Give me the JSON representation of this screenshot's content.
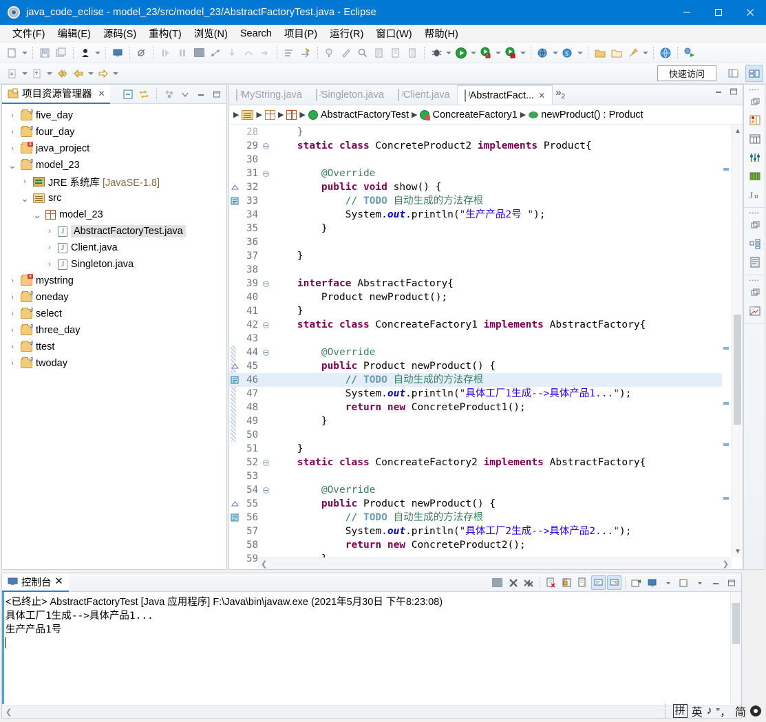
{
  "window": {
    "title": "java_code_eclise - model_23/src/model_23/AbstractFactoryTest.java - Eclipse",
    "app_icon": "eclipse-gear-icon",
    "minimize_label": "—",
    "maximize_label": "□",
    "close_label": "✕",
    "accent_color": "#0078d4"
  },
  "menubar": {
    "items": [
      {
        "label": "文件(F)",
        "name": "menu-file"
      },
      {
        "label": "编辑(E)",
        "name": "menu-edit"
      },
      {
        "label": "源码(S)",
        "name": "menu-source"
      },
      {
        "label": "重构(T)",
        "name": "menu-refactor"
      },
      {
        "label": "浏览(N)",
        "name": "menu-navigate"
      },
      {
        "label": "Search",
        "name": "menu-search"
      },
      {
        "label": "项目(P)",
        "name": "menu-project"
      },
      {
        "label": "运行(R)",
        "name": "menu-run"
      },
      {
        "label": "窗口(W)",
        "name": "menu-window"
      },
      {
        "label": "帮助(H)",
        "name": "menu-help"
      }
    ]
  },
  "toolbar": {
    "quick_access_label": "快速访问",
    "row1_icons": [
      "new-wizard-icon",
      "new-dropdown-arrow",
      "save-icon",
      "save-all-icon",
      "debug-perspective-icon",
      "debug-dropdown-arrow",
      "console-icon",
      "skip-breakpoints-icon",
      "resume-icon",
      "suspend-icon",
      "terminate-icon",
      "disconnect-icon",
      "step-into-icon",
      "step-over-icon",
      "step-return-icon",
      "drop-to-frame-icon",
      "use-step-filters-icon",
      "open-type-icon",
      "open-task-icon",
      "search-icon",
      "last-edit-location-icon",
      "next-annotation-icon",
      "previous-annotation-icon",
      "toggle-mark-occurrences-icon"
    ],
    "row2_icons": [
      "back-history-icon",
      "back-dropdown-arrow",
      "forward-history-icon",
      "forward-dropdown-arrow",
      "previous-edit-icon",
      "back-arrow-icon",
      "back-dropdown-arrow2",
      "forward-arrow-icon",
      "forward-dropdown-arrow2"
    ],
    "right_icons": [
      "debug-bug-icon",
      "debug-dropdown",
      "run-icon",
      "run-dropdown",
      "run-external-icon",
      "run-external-dropdown",
      "coverage-icon",
      "coverage-dropdown",
      "new-java-project-icon",
      "new-java-project-dropdown",
      "new-class-icon",
      "new-class-dropdown",
      "open-folder-icon",
      "open-package-icon",
      "pin-icon",
      "pin-dropdown",
      "web-browser-icon",
      "run-config-icon"
    ],
    "perspective_icons": [
      "open-perspective-icon",
      "java-perspective-icon"
    ]
  },
  "explorer": {
    "tab_label": "项目资源管理器",
    "tab_icon": "package-explorer-icon",
    "close_label": "✕",
    "tools": [
      "collapse-all-icon",
      "link-with-editor-icon",
      "view-menu-filter-icon",
      "view-menu-icon",
      "minimize-icon",
      "maximize-icon"
    ],
    "tree": [
      {
        "label": "five_day",
        "icon": "java-project-icon",
        "depth": 0,
        "twisty": "collapsed",
        "selected": false
      },
      {
        "label": "four_day",
        "icon": "java-project-icon",
        "depth": 0,
        "twisty": "collapsed",
        "selected": false
      },
      {
        "label": "java_project",
        "icon": "java-project-error-icon",
        "depth": 0,
        "twisty": "collapsed",
        "selected": false
      },
      {
        "label": "model_23",
        "icon": "java-project-icon",
        "depth": 0,
        "twisty": "expanded",
        "selected": false
      },
      {
        "label": "JRE 系统库 [JavaSE-1.8]",
        "icon": "jre-library-icon",
        "depth": 1,
        "twisty": "collapsed",
        "selected": false
      },
      {
        "label": "src",
        "icon": "source-folder-icon",
        "depth": 1,
        "twisty": "expanded",
        "selected": false
      },
      {
        "label": "model_23",
        "icon": "package-icon",
        "depth": 2,
        "twisty": "expanded",
        "selected": false
      },
      {
        "label": "AbstractFactoryTest.java",
        "icon": "java-file-icon",
        "depth": 3,
        "twisty": "collapsed",
        "selected": true
      },
      {
        "label": "Client.java",
        "icon": "java-file-icon",
        "depth": 3,
        "twisty": "collapsed",
        "selected": false
      },
      {
        "label": "Singleton.java",
        "icon": "java-file-icon",
        "depth": 3,
        "twisty": "collapsed",
        "selected": false
      },
      {
        "label": "mystring",
        "icon": "java-project-error-icon",
        "depth": 0,
        "twisty": "collapsed",
        "selected": false
      },
      {
        "label": "oneday",
        "icon": "java-project-icon",
        "depth": 0,
        "twisty": "collapsed",
        "selected": false
      },
      {
        "label": "select",
        "icon": "java-project-icon",
        "depth": 0,
        "twisty": "collapsed",
        "selected": false
      },
      {
        "label": "three_day",
        "icon": "java-project-icon",
        "depth": 0,
        "twisty": "collapsed",
        "selected": false
      },
      {
        "label": "ttest",
        "icon": "java-project-icon",
        "depth": 0,
        "twisty": "collapsed",
        "selected": false
      },
      {
        "label": "twoday",
        "icon": "java-project-icon",
        "depth": 0,
        "twisty": "collapsed",
        "selected": false
      }
    ]
  },
  "editor": {
    "tabs": [
      {
        "label": "MyString.java",
        "active": false,
        "icon": "java-file-icon"
      },
      {
        "label": "Singleton.java",
        "active": false,
        "icon": "java-file-icon"
      },
      {
        "label": "Client.java",
        "active": false,
        "icon": "java-file-icon"
      },
      {
        "label": "AbstractFact...",
        "active": true,
        "icon": "java-file-icon",
        "close_label": "✕"
      }
    ],
    "more_tabs_label": "»",
    "more_tabs_count": "2",
    "minimize_label": "minimize-icon",
    "maximize_label": "maximize-icon",
    "breadcrumb": [
      {
        "label": "",
        "icon": "source-folder-icon"
      },
      {
        "label": "",
        "icon": "package-root-icon"
      },
      {
        "label": "",
        "icon": "package-icon"
      },
      {
        "label": "AbstractFactoryTest",
        "icon": "class-icon"
      },
      {
        "label": "ConcreateFactory1",
        "icon": "inner-class-icon"
      },
      {
        "label": "newProduct() : Product",
        "icon": "method-icon"
      }
    ],
    "highlighted_line": 46,
    "lines": [
      {
        "n": 28,
        "fold": false,
        "mark": "",
        "partial": true,
        "tokens": [
          {
            "t": "    }",
            "c": "plain"
          }
        ]
      },
      {
        "n": 29,
        "fold": true,
        "mark": "",
        "tokens": [
          {
            "t": "    ",
            "c": "plain"
          },
          {
            "t": "static class",
            "c": "kw"
          },
          {
            "t": " ConcreteProduct2 ",
            "c": "plain"
          },
          {
            "t": "implements",
            "c": "kw"
          },
          {
            "t": " Product{",
            "c": "plain"
          }
        ]
      },
      {
        "n": 30,
        "fold": false,
        "mark": "",
        "tokens": []
      },
      {
        "n": 31,
        "fold": true,
        "mark": "",
        "tokens": [
          {
            "t": "        @Override",
            "c": "cmt2"
          }
        ]
      },
      {
        "n": 32,
        "fold": false,
        "mark": "warning",
        "tokens": [
          {
            "t": "        ",
            "c": "plain"
          },
          {
            "t": "public void",
            "c": "kw"
          },
          {
            "t": " show() {",
            "c": "plain"
          }
        ]
      },
      {
        "n": 33,
        "fold": false,
        "mark": "todo",
        "tokens": [
          {
            "t": "            ",
            "c": "plain"
          },
          {
            "t": "// ",
            "c": "cmt"
          },
          {
            "t": "TODO",
            "c": "todo"
          },
          {
            "t": " 自动生成的方法存根",
            "c": "cmt"
          }
        ]
      },
      {
        "n": 34,
        "fold": false,
        "mark": "",
        "tokens": [
          {
            "t": "            System.",
            "c": "plain"
          },
          {
            "t": "out",
            "c": "fld"
          },
          {
            "t": ".println(",
            "c": "plain"
          },
          {
            "t": "\"生产产品2号 \"",
            "c": "str"
          },
          {
            "t": ");",
            "c": "plain"
          }
        ]
      },
      {
        "n": 35,
        "fold": false,
        "mark": "",
        "tokens": [
          {
            "t": "        }",
            "c": "plain"
          }
        ]
      },
      {
        "n": 36,
        "fold": false,
        "mark": "",
        "tokens": []
      },
      {
        "n": 37,
        "fold": false,
        "mark": "",
        "tokens": [
          {
            "t": "    }",
            "c": "plain"
          }
        ]
      },
      {
        "n": 38,
        "fold": false,
        "mark": "",
        "tokens": []
      },
      {
        "n": 39,
        "fold": true,
        "mark": "",
        "tokens": [
          {
            "t": "    ",
            "c": "plain"
          },
          {
            "t": "interface",
            "c": "kw"
          },
          {
            "t": " AbstractFactory{",
            "c": "plain"
          }
        ]
      },
      {
        "n": 40,
        "fold": false,
        "mark": "",
        "tokens": [
          {
            "t": "        Product newProduct();",
            "c": "plain"
          }
        ]
      },
      {
        "n": 41,
        "fold": false,
        "mark": "",
        "tokens": [
          {
            "t": "    }",
            "c": "plain"
          }
        ]
      },
      {
        "n": 42,
        "fold": true,
        "mark": "",
        "tokens": [
          {
            "t": "    ",
            "c": "plain"
          },
          {
            "t": "static class",
            "c": "kw"
          },
          {
            "t": " ConcreateFactory1 ",
            "c": "plain"
          },
          {
            "t": "implements",
            "c": "kw"
          },
          {
            "t": " AbstractFactory{",
            "c": "plain"
          }
        ]
      },
      {
        "n": 43,
        "fold": false,
        "mark": "",
        "tokens": []
      },
      {
        "n": 44,
        "fold": true,
        "mark": "",
        "tokens": [
          {
            "t": "        @Override",
            "c": "cmt2"
          }
        ]
      },
      {
        "n": 45,
        "fold": false,
        "mark": "warning",
        "tokens": [
          {
            "t": "        ",
            "c": "plain"
          },
          {
            "t": "public",
            "c": "kw"
          },
          {
            "t": " Product newProduct() {",
            "c": "plain"
          }
        ]
      },
      {
        "n": 46,
        "fold": false,
        "mark": "todo",
        "tokens": [
          {
            "t": "            ",
            "c": "plain"
          },
          {
            "t": "// ",
            "c": "cmt"
          },
          {
            "t": "TODO",
            "c": "todo"
          },
          {
            "t": " 自动生成的方法存根",
            "c": "cmt"
          }
        ]
      },
      {
        "n": 47,
        "fold": false,
        "mark": "",
        "tokens": [
          {
            "t": "            System.",
            "c": "plain"
          },
          {
            "t": "out",
            "c": "fld"
          },
          {
            "t": ".println(",
            "c": "plain"
          },
          {
            "t": "\"具体工厂1生成-->具体产品1...\"",
            "c": "str"
          },
          {
            "t": ");",
            "c": "plain"
          }
        ]
      },
      {
        "n": 48,
        "fold": false,
        "mark": "",
        "tokens": [
          {
            "t": "            ",
            "c": "plain"
          },
          {
            "t": "return new",
            "c": "kw"
          },
          {
            "t": " ConcreteProduct1();",
            "c": "plain"
          }
        ]
      },
      {
        "n": 49,
        "fold": false,
        "mark": "",
        "tokens": [
          {
            "t": "        }",
            "c": "plain"
          }
        ]
      },
      {
        "n": 50,
        "fold": false,
        "mark": "",
        "tokens": []
      },
      {
        "n": 51,
        "fold": false,
        "mark": "",
        "tokens": [
          {
            "t": "    }",
            "c": "plain"
          }
        ]
      },
      {
        "n": 52,
        "fold": true,
        "mark": "",
        "tokens": [
          {
            "t": "    ",
            "c": "plain"
          },
          {
            "t": "static class",
            "c": "kw"
          },
          {
            "t": " ConcreateFactory2 ",
            "c": "plain"
          },
          {
            "t": "implements",
            "c": "kw"
          },
          {
            "t": " AbstractFactory{",
            "c": "plain"
          }
        ]
      },
      {
        "n": 53,
        "fold": false,
        "mark": "",
        "tokens": []
      },
      {
        "n": 54,
        "fold": true,
        "mark": "",
        "tokens": [
          {
            "t": "        @Override",
            "c": "cmt2"
          }
        ]
      },
      {
        "n": 55,
        "fold": false,
        "mark": "warning",
        "tokens": [
          {
            "t": "        ",
            "c": "plain"
          },
          {
            "t": "public",
            "c": "kw"
          },
          {
            "t": " Product newProduct() {",
            "c": "plain"
          }
        ]
      },
      {
        "n": 56,
        "fold": false,
        "mark": "todo",
        "tokens": [
          {
            "t": "            ",
            "c": "plain"
          },
          {
            "t": "// ",
            "c": "cmt"
          },
          {
            "t": "TODO",
            "c": "todo"
          },
          {
            "t": " 自动生成的方法存根",
            "c": "cmt"
          }
        ]
      },
      {
        "n": 57,
        "fold": false,
        "mark": "",
        "tokens": [
          {
            "t": "            System.",
            "c": "plain"
          },
          {
            "t": "out",
            "c": "fld"
          },
          {
            "t": ".println(",
            "c": "plain"
          },
          {
            "t": "\"具体工厂2生成-->具体产品2...\"",
            "c": "str"
          },
          {
            "t": ");",
            "c": "plain"
          }
        ]
      },
      {
        "n": 58,
        "fold": false,
        "mark": "",
        "tokens": [
          {
            "t": "            ",
            "c": "plain"
          },
          {
            "t": "return new",
            "c": "kw"
          },
          {
            "t": " ConcreteProduct2();",
            "c": "plain"
          }
        ]
      },
      {
        "n": 59,
        "fold": false,
        "mark": "",
        "tokens": [
          {
            "t": "        }",
            "c": "plain"
          }
        ]
      }
    ]
  },
  "console": {
    "tab_label": "控制台",
    "tab_icon": "console-icon",
    "close_label": "✕",
    "tools": [
      "terminate-icon",
      "remove-launch-icon",
      "remove-all-launches-icon",
      "clear-console-icon",
      "scroll-lock-icon",
      "word-wrap-icon",
      "show-console-on-output-icon",
      "show-console-on-error-icon",
      "pin-console-icon",
      "display-selected-console-icon",
      "display-console-dropdown",
      "open-console-icon",
      "open-console-dropdown",
      "minimize-icon",
      "maximize-icon"
    ],
    "header": "<已终止> AbstractFactoryTest [Java 应用程序] F:\\Java\\bin\\javaw.exe  (2021年5月30日 下午8:23:08)",
    "output": [
      "具体工厂1生成-->具体产品1...",
      "生产产品1号 "
    ]
  },
  "fastview": {
    "groups": [
      {
        "icons": [
          "restore-icon",
          "debug-view-icon",
          "variables-view-icon",
          "breakpoints-view-icon",
          "expressions-view-icon",
          "junit-view-icon"
        ]
      },
      {
        "icons": [
          "restore-icon",
          "outline-view-icon",
          "task-list-icon"
        ]
      },
      {
        "icons": [
          "restore-icon",
          "problems-view-icon"
        ]
      }
    ]
  },
  "ime": {
    "mode_label": "拼",
    "lang_label": "英",
    "note_label": "♪",
    "punct_label": "”，",
    "simplified_label": "简",
    "settings_icon": "gear-icon"
  }
}
